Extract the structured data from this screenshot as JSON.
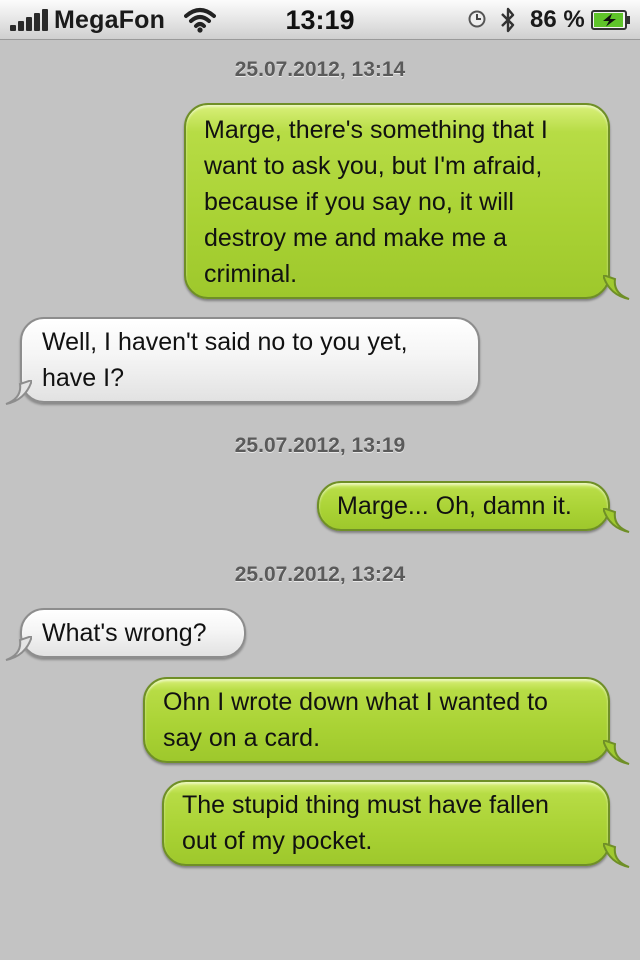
{
  "status_bar": {
    "carrier": "MegaFon",
    "time": "13:19",
    "battery_percent": "86 %",
    "icons": [
      "signal-icon",
      "wifi-icon",
      "alarm-clock-icon",
      "bluetooth-icon",
      "battery-charging-icon"
    ],
    "signal_bars": 5
  },
  "thread": {
    "timestamps": [
      "25.07.2012, 13:14",
      "25.07.2012, 13:19",
      "25.07.2012, 13:24"
    ],
    "messages": [
      {
        "direction": "sent",
        "text": "Marge, there's something that I\nwant to ask you, but I'm afraid,\nbecause if you say no, it will\ndestroy me and make me a\ncriminal."
      },
      {
        "direction": "received",
        "text": "Well, I haven't said no to you yet,\nhave I?"
      },
      {
        "direction": "sent",
        "text": "Marge... Oh, damn it."
      },
      {
        "direction": "received",
        "text": "What's wrong?"
      },
      {
        "direction": "sent",
        "text": "Ohn I wrote down what I wanted to\nsay on a card."
      },
      {
        "direction": "sent",
        "text": "The stupid thing must have fallen\nout of my pocket."
      }
    ]
  },
  "colors": {
    "background": "#c3c3c3",
    "sent_bubble": "#a9d234",
    "received_bubble": "#f0f0f0",
    "timestamp_text": "#5a5a5a"
  }
}
